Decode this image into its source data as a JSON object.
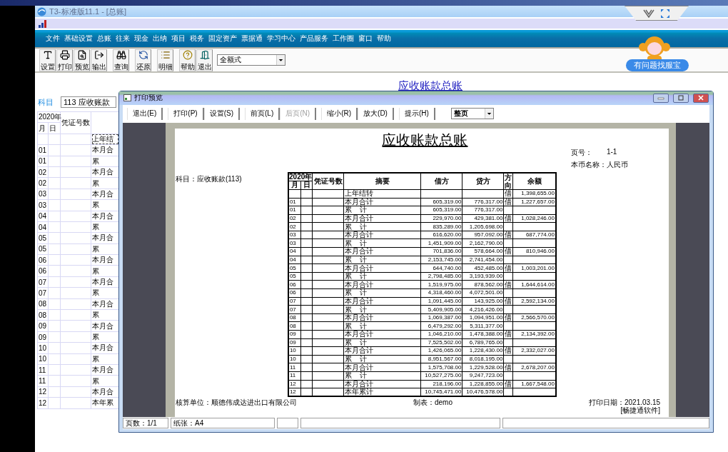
{
  "app_window": {
    "title": "T3-标准版11.1 - [总账]"
  },
  "menu": [
    "文件",
    "基础设置",
    "总账",
    "往来",
    "现金",
    "出纳",
    "项目",
    "税务",
    "固定资产",
    "票据通",
    "学习中心",
    "产品服务",
    "工作圈",
    "窗口",
    "帮助"
  ],
  "toolbar": {
    "buttons": [
      {
        "label": "设置"
      },
      {
        "label": "打印"
      },
      {
        "label": "预览"
      },
      {
        "label": "输出"
      },
      {
        "label": "查询"
      },
      {
        "label": "还原"
      },
      {
        "label": "明细"
      },
      {
        "label": "帮助"
      },
      {
        "label": "退出"
      }
    ],
    "format_select": {
      "value": "全额式"
    }
  },
  "helper_badge": "有问题找服宝",
  "ledger": {
    "heading": "应收账款总账",
    "subject_label": "科目",
    "subject_value": "113 应收账款",
    "columns": {
      "year": "2020年",
      "month": "月",
      "day": "日",
      "voucher": "凭证号数"
    },
    "rows": [
      {
        "month": "",
        "summary": "上年结",
        "selected": true
      },
      {
        "month": "01",
        "summary": "本月合",
        "selected": false
      },
      {
        "month": "01",
        "summary": "累",
        "selected": false
      },
      {
        "month": "02",
        "summary": "本月合",
        "selected": false
      },
      {
        "month": "02",
        "summary": "累",
        "selected": false
      },
      {
        "month": "03",
        "summary": "本月合",
        "selected": false
      },
      {
        "month": "03",
        "summary": "累",
        "selected": false
      },
      {
        "month": "04",
        "summary": "本月合",
        "selected": false
      },
      {
        "month": "04",
        "summary": "累",
        "selected": false
      },
      {
        "month": "05",
        "summary": "本月合",
        "selected": false
      },
      {
        "month": "05",
        "summary": "累",
        "selected": false
      },
      {
        "month": "06",
        "summary": "本月合",
        "selected": false
      },
      {
        "month": "06",
        "summary": "累",
        "selected": false
      },
      {
        "month": "07",
        "summary": "本月合",
        "selected": false
      },
      {
        "month": "07",
        "summary": "累",
        "selected": false
      },
      {
        "month": "08",
        "summary": "本月合",
        "selected": false
      },
      {
        "month": "08",
        "summary": "累",
        "selected": false
      },
      {
        "month": "09",
        "summary": "本月合",
        "selected": false
      },
      {
        "month": "09",
        "summary": "累",
        "selected": false
      },
      {
        "month": "10",
        "summary": "本月合",
        "selected": false
      },
      {
        "month": "10",
        "summary": "累",
        "selected": false
      },
      {
        "month": "11",
        "summary": "本月合",
        "selected": false
      },
      {
        "month": "11",
        "summary": "累",
        "selected": false
      },
      {
        "month": "12",
        "summary": "本月合",
        "selected": false
      },
      {
        "month": "12",
        "summary": "本年累",
        "selected": false
      }
    ]
  },
  "print_preview": {
    "title": "打印预览",
    "buttons": [
      {
        "label": "退出(E)",
        "disabled": false
      },
      {
        "label": "打印(P)",
        "disabled": false
      },
      {
        "label": "设置(S)",
        "disabled": false
      },
      {
        "label": "前页(L)",
        "disabled": false
      },
      {
        "label": "后页(N)",
        "disabled": true
      },
      {
        "label": "缩小(R)",
        "disabled": false
      },
      {
        "label": "放大(D)",
        "disabled": false
      },
      {
        "label": "提示(H)",
        "disabled": false
      }
    ],
    "zoom_select": {
      "value": "整页"
    },
    "page": {
      "title": "应收账款总账",
      "page_no_label": "页号：",
      "page_no": "1-1",
      "currency": "本币名称：人民币",
      "subject": "科目：应收账款(113)",
      "columns": {
        "year": "2020年",
        "month": "月",
        "day": "日",
        "voucher": "凭证号数",
        "summary": "摘要",
        "debit": "借方",
        "credit": "贷方",
        "direction": "方向",
        "balance": "余额"
      },
      "rows": [
        {
          "month": "",
          "summary": "上年结转",
          "debit": "",
          "credit": "",
          "direction": "借",
          "balance": "1,398,655.00"
        },
        {
          "month": "01",
          "summary": "本月合计",
          "debit": "605,319.00",
          "credit": "776,317.00",
          "direction": "借",
          "balance": "1,227,657.00"
        },
        {
          "month": "01",
          "summary": "累    计",
          "debit": "605,319.00",
          "credit": "776,317.00",
          "direction": "",
          "balance": ""
        },
        {
          "month": "02",
          "summary": "本月合计",
          "debit": "229,970.00",
          "credit": "429,381.00",
          "direction": "借",
          "balance": "1,028,246.00"
        },
        {
          "month": "02",
          "summary": "累    计",
          "debit": "835,289.00",
          "credit": "1,205,698.00",
          "direction": "",
          "balance": ""
        },
        {
          "month": "03",
          "summary": "本月合计",
          "debit": "616,620.00",
          "credit": "957,092.00",
          "direction": "借",
          "balance": "687,774.00"
        },
        {
          "month": "03",
          "summary": "累    计",
          "debit": "1,451,909.00",
          "credit": "2,162,790.00",
          "direction": "",
          "balance": ""
        },
        {
          "month": "04",
          "summary": "本月合计",
          "debit": "701,836.00",
          "credit": "578,664.00",
          "direction": "借",
          "balance": "810,946.00"
        },
        {
          "month": "04",
          "summary": "累    计",
          "debit": "2,153,745.00",
          "credit": "2,741,454.00",
          "direction": "",
          "balance": ""
        },
        {
          "month": "05",
          "summary": "本月合计",
          "debit": "644,740.00",
          "credit": "452,485.00",
          "direction": "借",
          "balance": "1,003,201.00"
        },
        {
          "month": "05",
          "summary": "累    计",
          "debit": "2,798,485.00",
          "credit": "3,193,939.00",
          "direction": "",
          "balance": ""
        },
        {
          "month": "06",
          "summary": "本月合计",
          "debit": "1,519,975.00",
          "credit": "878,562.00",
          "direction": "借",
          "balance": "1,644,614.00"
        },
        {
          "month": "06",
          "summary": "累    计",
          "debit": "4,318,460.00",
          "credit": "4,072,501.00",
          "direction": "",
          "balance": ""
        },
        {
          "month": "07",
          "summary": "本月合计",
          "debit": "1,091,445.00",
          "credit": "143,925.00",
          "direction": "借",
          "balance": "2,592,134.00"
        },
        {
          "month": "07",
          "summary": "累    计",
          "debit": "5,409,905.00",
          "credit": "4,216,426.00",
          "direction": "",
          "balance": ""
        },
        {
          "month": "08",
          "summary": "本月合计",
          "debit": "1,069,387.00",
          "credit": "1,094,951.00",
          "direction": "借",
          "balance": "2,566,570.00"
        },
        {
          "month": "08",
          "summary": "累    计",
          "debit": "6,479,292.00",
          "credit": "5,311,377.00",
          "direction": "",
          "balance": ""
        },
        {
          "month": "09",
          "summary": "本月合计",
          "debit": "1,046,210.00",
          "credit": "1,478,388.00",
          "direction": "借",
          "balance": "2,134,392.00"
        },
        {
          "month": "09",
          "summary": "累    计",
          "debit": "7,525,502.00",
          "credit": "6,789,765.00",
          "direction": "",
          "balance": ""
        },
        {
          "month": "10",
          "summary": "本月合计",
          "debit": "1,426,065.00",
          "credit": "1,228,430.00",
          "direction": "借",
          "balance": "2,332,027.00"
        },
        {
          "month": "10",
          "summary": "累    计",
          "debit": "8,951,567.00",
          "credit": "8,018,195.00",
          "direction": "",
          "balance": ""
        },
        {
          "month": "11",
          "summary": "本月合计",
          "debit": "1,575,708.00",
          "credit": "1,229,528.00",
          "direction": "借",
          "balance": "2,678,207.00"
        },
        {
          "month": "11",
          "summary": "累    计",
          "debit": "10,527,275.00",
          "credit": "9,247,723.00",
          "direction": "",
          "balance": ""
        },
        {
          "month": "12",
          "summary": "本月合计",
          "debit": "218,196.00",
          "credit": "1,228,855.00",
          "direction": "借",
          "balance": "1,667,548.00"
        },
        {
          "month": "12",
          "summary": "本年累计",
          "debit": "10,745,471.00",
          "credit": "10,476,578.00",
          "direction": "",
          "balance": ""
        }
      ],
      "unit": "核算单位：顺德伟成达进出口有限公司",
      "maker": "制表：demo",
      "print_date": "打印日期：2021.03.15",
      "software": "[畅捷通软件]"
    },
    "status_bar": {
      "pages": "页数：1/1",
      "paper": "纸张：A4"
    }
  }
}
